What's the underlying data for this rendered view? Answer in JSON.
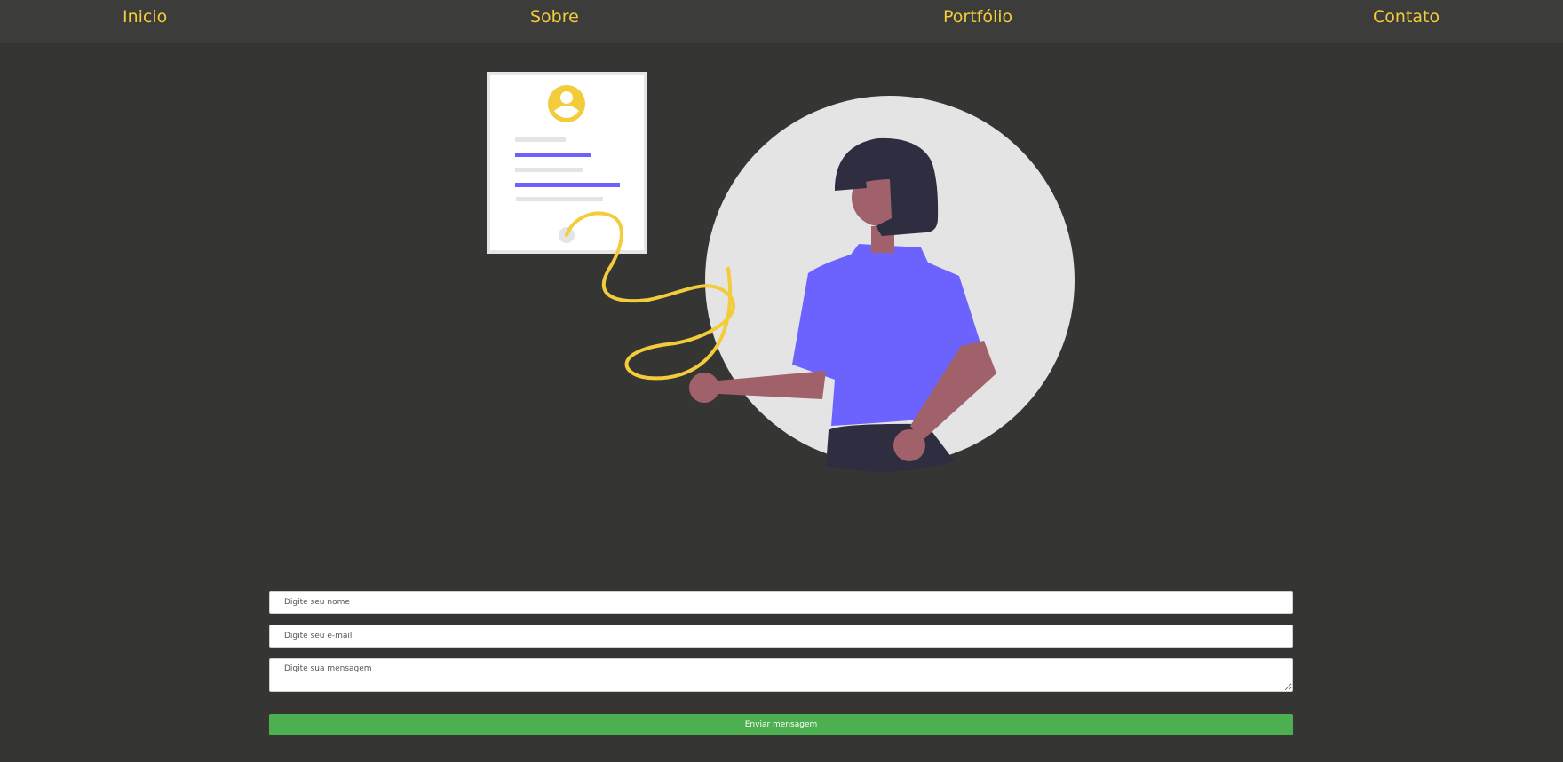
{
  "nav": {
    "items": [
      {
        "label": "Inicio"
      },
      {
        "label": "Sobre"
      },
      {
        "label": "Portfólio"
      },
      {
        "label": "Contato"
      }
    ]
  },
  "hero": {
    "illustration_icon": "person-with-profile-card-illustration"
  },
  "form": {
    "name_placeholder": "Digite seu nome",
    "email_placeholder": "Digite seu e-mail",
    "message_placeholder": "Digite sua mensagem",
    "submit_label": "Enviar mensagem"
  },
  "colors": {
    "background": "#353533",
    "nav_background": "#3c3c3b",
    "accent": "#f2cc3b",
    "purple": "#6c63ff",
    "button": "#4caf50"
  }
}
